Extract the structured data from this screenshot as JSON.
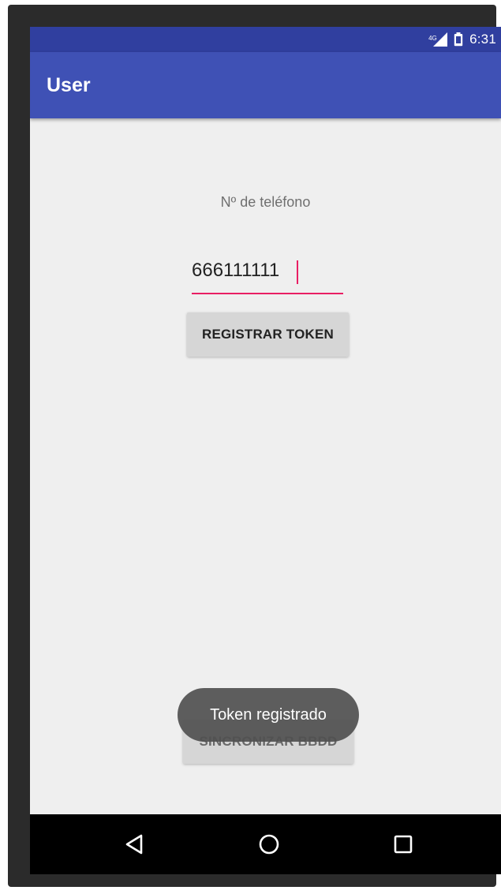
{
  "status_bar": {
    "time": "6:31",
    "network": "4G",
    "icons": [
      "signal-icon",
      "battery-icon"
    ]
  },
  "app_bar": {
    "title": "User"
  },
  "form": {
    "phone_label": "Nº de teléfono",
    "phone_value": "666111111",
    "register_button": "REGISTRAR TOKEN",
    "sync_button": "SINCRONIZAR BBDD"
  },
  "toast": {
    "message": "Token registrado"
  },
  "nav_bar": {
    "icons": [
      "back-icon",
      "home-icon",
      "recents-icon"
    ]
  },
  "colors": {
    "status_bar": "#303f9f",
    "app_bar": "#3f51b5",
    "accent": "#e91e63",
    "background": "#efefef"
  }
}
